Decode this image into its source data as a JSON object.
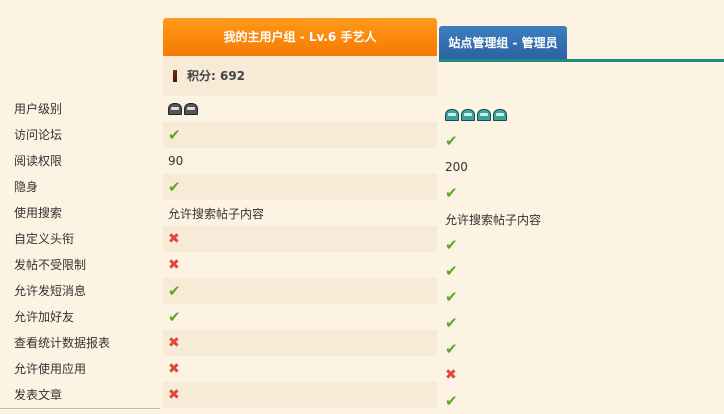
{
  "labels": [
    "用户级别",
    "访问论坛",
    "阅读权限",
    "隐身",
    "使用搜索",
    "自定义头衔",
    "发帖不受限制",
    "允许发短消息",
    "允许加好友",
    "查看统计数据报表",
    "允许使用应用",
    "发表文章"
  ],
  "group1": {
    "title": "我的主用户组 - Lv.6 手艺人",
    "score_label": "积分: 692",
    "level_icon_count": 2,
    "values": [
      "icons",
      "check",
      "90",
      "check",
      "允许搜索帖子内容",
      "cross",
      "cross",
      "check",
      "check",
      "cross",
      "cross",
      "cross"
    ]
  },
  "group2": {
    "title": "站点管理组 - 管理员",
    "level_icon_count": 4,
    "values": [
      "icons",
      "check",
      "200",
      "check",
      "允许搜索帖子内容",
      "check",
      "check",
      "check",
      "check",
      "check",
      "cross",
      "check"
    ]
  },
  "colors": {
    "check": "#5aaa1e",
    "cross": "#e0473c",
    "group1_header": "#f57a00",
    "group2_header": "#2b61a0",
    "accent_line": "#1f8b7d"
  }
}
